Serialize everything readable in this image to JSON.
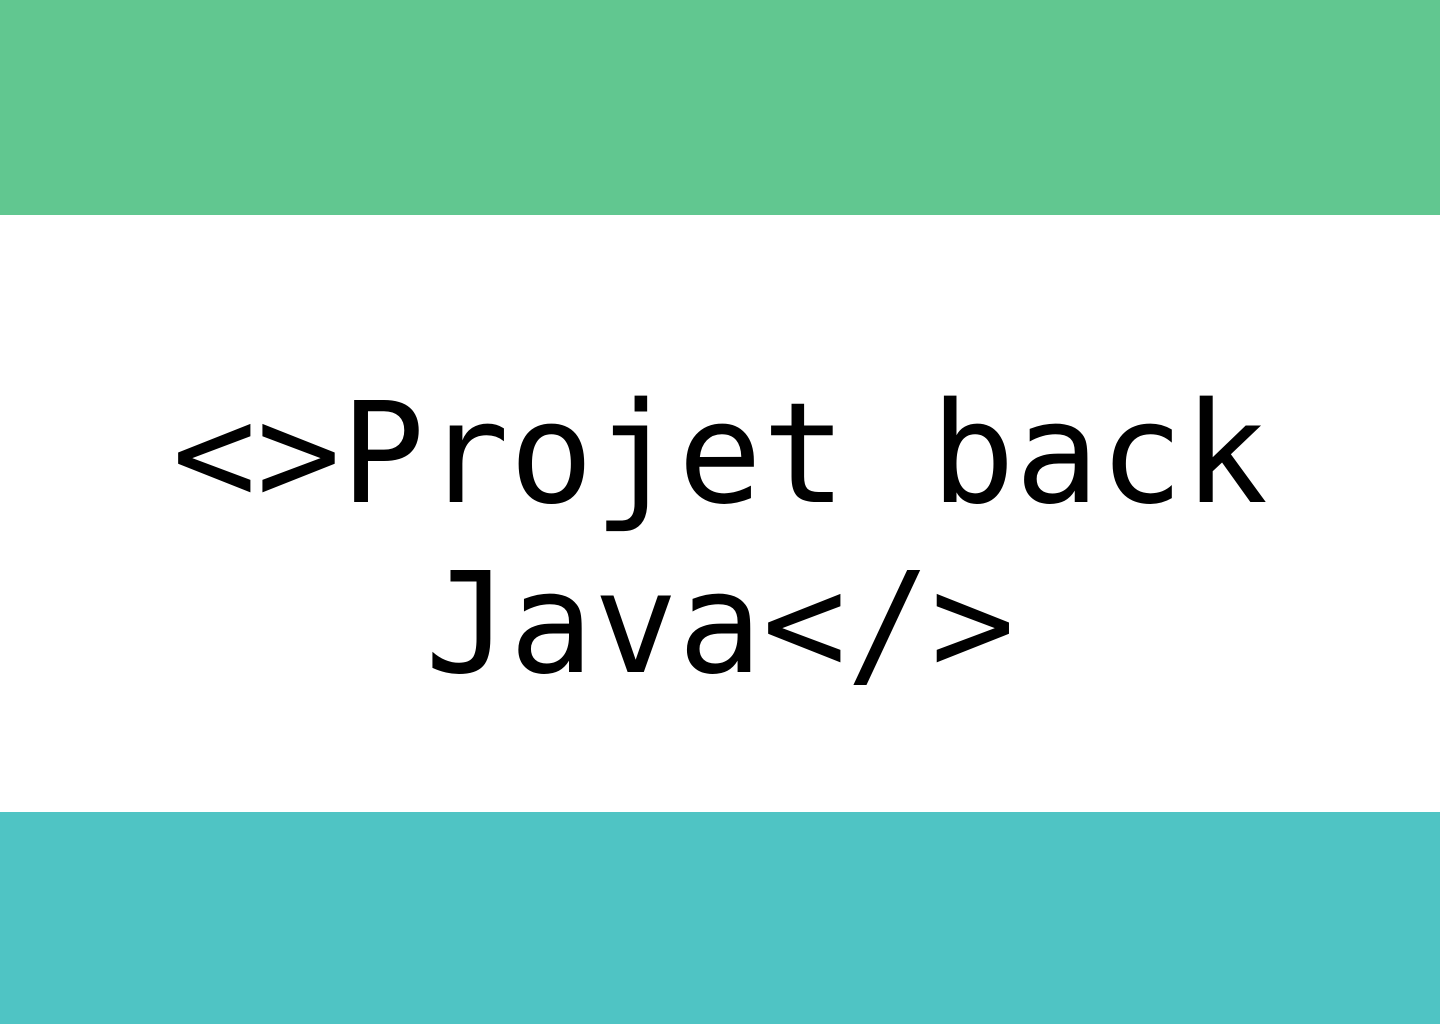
{
  "colors": {
    "top_band": "#61c790",
    "bottom_band": "#4fc4c4",
    "background": "#ffffff",
    "text": "#000000"
  },
  "title": {
    "line1": "<>Projet back",
    "line2": "Java</>"
  }
}
